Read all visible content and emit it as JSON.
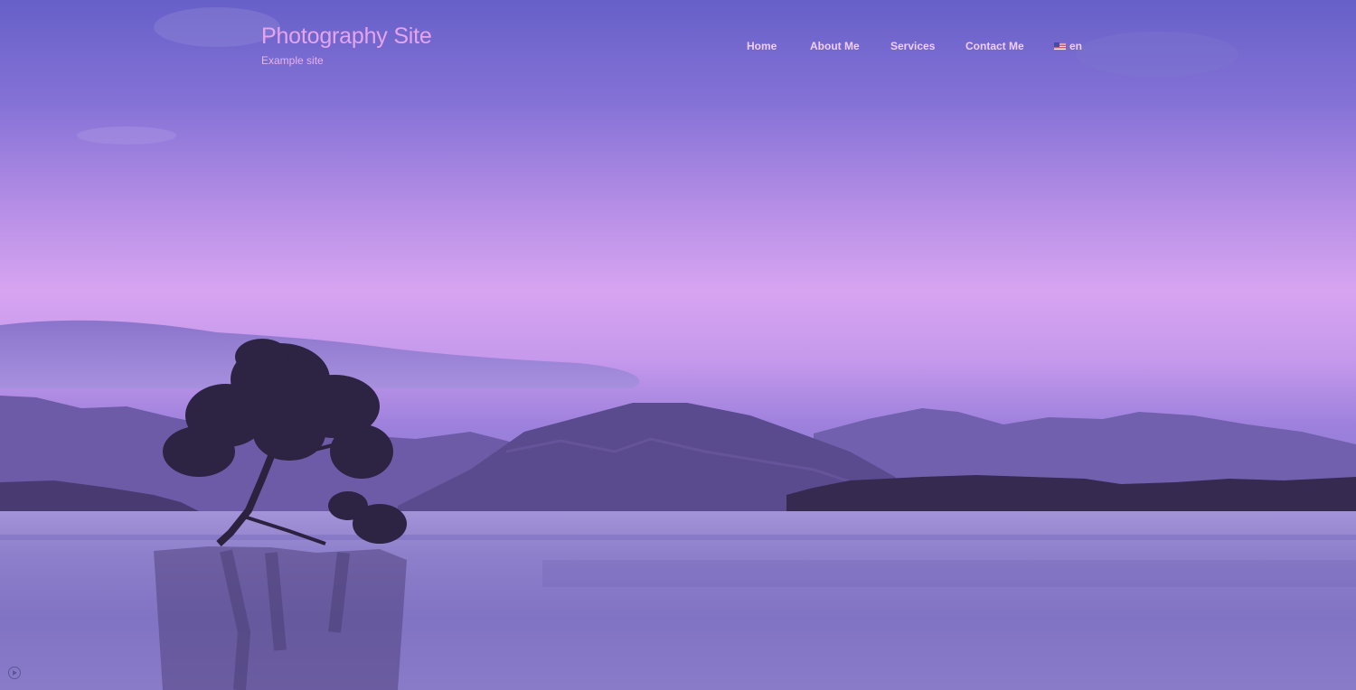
{
  "site": {
    "title": "Photography Site",
    "tagline": "Example site"
  },
  "nav": {
    "items": [
      {
        "label": "Home"
      },
      {
        "label": "About Me"
      },
      {
        "label": "Services"
      },
      {
        "label": "Contact Me"
      }
    ],
    "language": {
      "label": "en",
      "icon": "us-flag-icon"
    }
  },
  "hero": {
    "image": "lake-tree-mountains-landscape",
    "overlay_color": "#7a62d6",
    "play_icon": "play-circle-icon"
  },
  "colors": {
    "title": "#e6a4ef",
    "nav_text": "#f0cff5",
    "sky_top": "#6560c8",
    "sky_mid": "#d9a5f1"
  }
}
